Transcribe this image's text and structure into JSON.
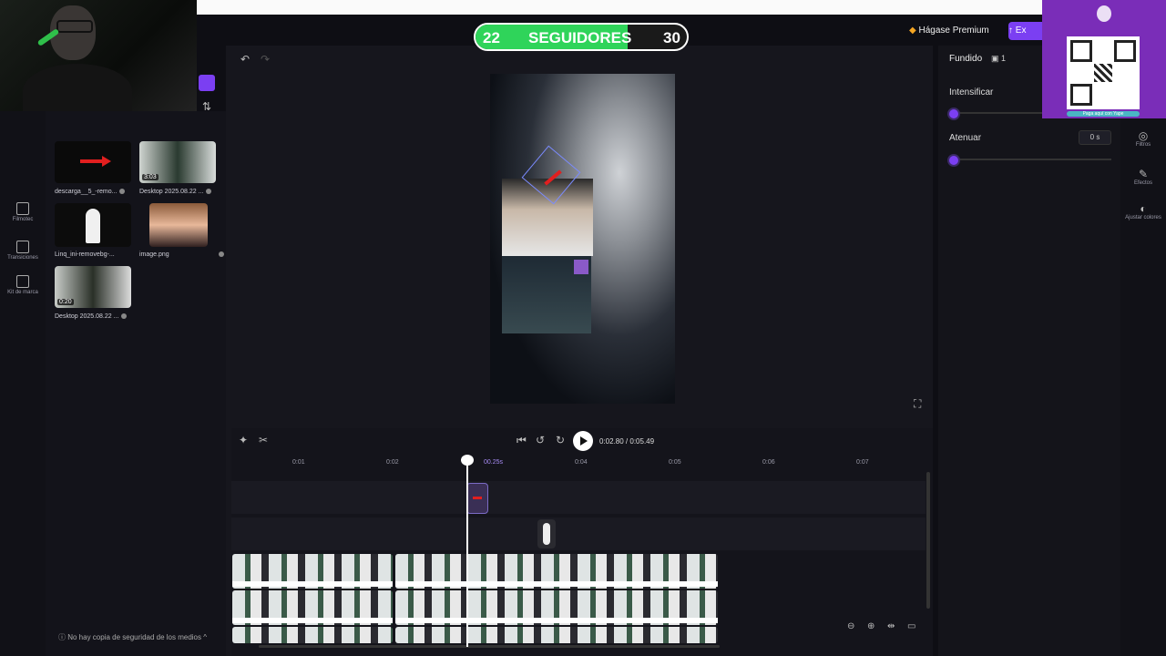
{
  "counter": {
    "left": "22",
    "label": "SEGUIDORES",
    "right": "30",
    "progress": 0.72
  },
  "header": {
    "premium_label": "Hágase Premium",
    "export_label": "Ex"
  },
  "media": {
    "items": [
      {
        "caption": "descarga__5_-remo...",
        "duration": ""
      },
      {
        "caption": "Desktop 2025.08.22 ...",
        "duration": "3:03"
      },
      {
        "caption": "Linq_ini-removebg-...",
        "duration": ""
      },
      {
        "caption": "image.png",
        "duration": ""
      },
      {
        "caption": "Desktop 2025.08.22 ...",
        "duration": "0:20"
      }
    ],
    "backup_notice": "No hay copia de seguridad de los medios"
  },
  "rail": {
    "items": [
      {
        "label": "Filmotec"
      },
      {
        "label": "Transiciones"
      },
      {
        "label": "Kit de marca"
      }
    ]
  },
  "playback": {
    "current": "0:02.80",
    "total": "0:05.49",
    "sep": " / "
  },
  "ruler": {
    "ticks": [
      "0:01",
      "0:02",
      "00.25s",
      "0:04",
      "0:05",
      "0:06",
      "0:07"
    ]
  },
  "rightpanel": {
    "title": "Fundido",
    "count": "1",
    "fade_in_label": "Intensificar",
    "fade_out_label": "Atenuar",
    "fade_out_value": "0",
    "fade_out_unit": "s",
    "fade_in": 0,
    "fade_out": 0,
    "tools": [
      {
        "label": "Filtros"
      },
      {
        "label": "Efectos"
      },
      {
        "label": "Ajustar colores"
      }
    ]
  },
  "qr": {
    "caption": "Paga aquí con Yape"
  },
  "colors": {
    "accent": "#7b3ff2",
    "counter_fill": "#2fd45a"
  }
}
